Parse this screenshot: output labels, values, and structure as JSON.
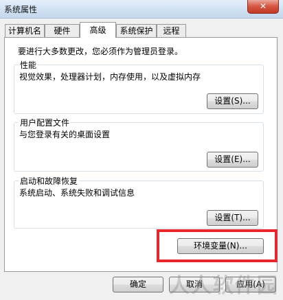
{
  "window": {
    "title": "系统属性",
    "close_symbol": "✕"
  },
  "tabs": [
    {
      "label": "计算机名"
    },
    {
      "label": "硬件"
    },
    {
      "label": "高级",
      "active": true
    },
    {
      "label": "系统保护"
    },
    {
      "label": "远程"
    }
  ],
  "admin_note": "要进行大多数更改，您必须作为管理员登录。",
  "performance": {
    "title": "性能",
    "description": "视觉效果，处理器计划，内存使用，以及虚拟内存",
    "button": "设置(S)..."
  },
  "user_profiles": {
    "title": "用户配置文件",
    "description": "与您登录有关的桌面设置",
    "button": "设置(E)..."
  },
  "startup_recovery": {
    "title": "启动和故障恢复",
    "description": "系统启动、系统失败和调试信息",
    "button": "设置(T)..."
  },
  "env_button": "环境变量(N)...",
  "footer": {
    "ok": "确定",
    "cancel": "取消",
    "apply": "应用(A)"
  },
  "watermark": "人人软件园",
  "colors": {
    "highlight": "#e8262c",
    "titlebar": "#cfe0f2",
    "close": "#c03a26"
  }
}
